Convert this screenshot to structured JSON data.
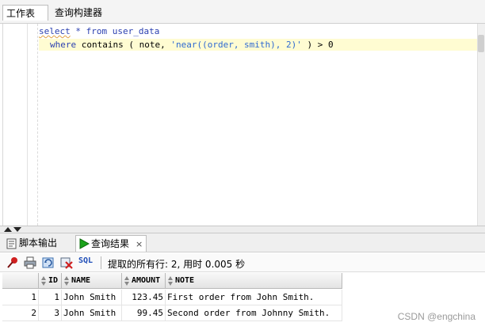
{
  "top_tabs": [
    {
      "label": "工作表"
    },
    {
      "label": "查询构建器"
    }
  ],
  "editor": {
    "line1": {
      "kw1": "select",
      "star": "*",
      "kw2": "from",
      "table": "user_data"
    },
    "line2": {
      "kw1": "where",
      "kw2": "contains",
      "args": "( note, ",
      "str": "'near((order, smith), 2)'",
      "rest": " ) > 0"
    }
  },
  "bottom_tabs": [
    {
      "label": "脚本输出",
      "icon": "script-output-icon"
    },
    {
      "label": "查询结果",
      "icon": "run-query-icon",
      "close": "×"
    }
  ],
  "toolbar": {
    "sql_label": "SQL",
    "status": "提取的所有行: 2, 用时 0.005 秒"
  },
  "results": {
    "columns": [
      "ID",
      "NAME",
      "AMOUNT",
      "NOTE"
    ],
    "rows": [
      {
        "rownum": "1",
        "id": "1",
        "name": "John Smith",
        "amount": "123.45",
        "note": "First order from John Smith."
      },
      {
        "rownum": "2",
        "id": "3",
        "name": "John Smith",
        "amount": "99.45",
        "note": "Second order from Johnny Smith."
      }
    ]
  },
  "watermark": "CSDN @engchina",
  "colors": {
    "keyword": "#2a3fb0",
    "string": "#2e6ad1",
    "current_line": "#fffcd2",
    "run_green": "#1aa31a",
    "pin_red": "#d02020"
  }
}
